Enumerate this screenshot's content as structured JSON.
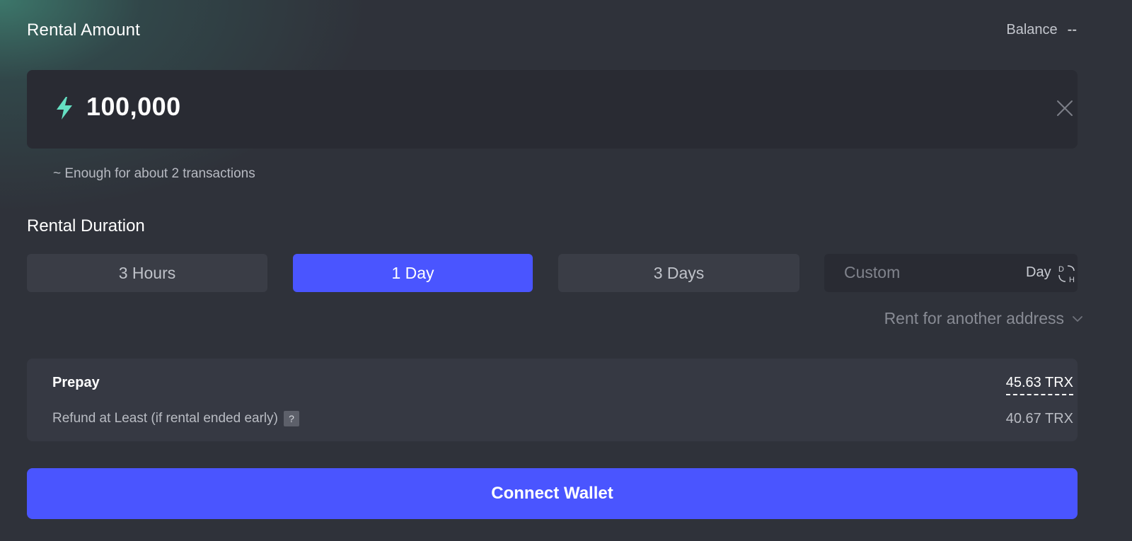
{
  "colors": {
    "background": "#2f323a",
    "accent": "#4a55ff",
    "input_background": "#292b33",
    "summary_background": "#363943",
    "bolt_icon": "#65e0c3"
  },
  "rental_amount": {
    "label": "Rental Amount",
    "balance_label": "Balance",
    "balance_value": "--",
    "amount": "100,000",
    "amount_icon": "bolt-icon",
    "clear_icon": "close-icon",
    "hint": "~ Enough for about 2 transactions"
  },
  "rental_duration": {
    "label": "Rental Duration",
    "options": [
      "3 Hours",
      "1 Day",
      "3 Days"
    ],
    "selected": "1 Day",
    "custom_placeholder": "Custom",
    "custom_unit": "Day",
    "unit_toggle_icon": "unit-switch-icon"
  },
  "rent_other": {
    "label": "Rent for another address"
  },
  "summary": {
    "prepay_label": "Prepay",
    "prepay_value": "45.63 TRX",
    "refund_label": "Refund at Least (if rental ended early)",
    "refund_help": "?",
    "refund_value": "40.67 TRX"
  },
  "actions": {
    "connect_wallet": "Connect Wallet"
  }
}
